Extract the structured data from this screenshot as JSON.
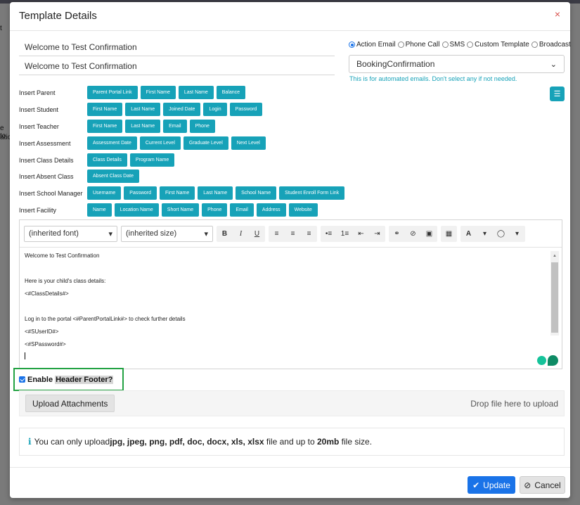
{
  "background": {
    "left_fragments": [
      "t",
      "e to",
      "ation"
    ]
  },
  "modal": {
    "title": "Template Details",
    "close_icon": "×",
    "subject1": "Welcome to Test Confirmation",
    "subject2": "Welcome to Test Confirmation",
    "radio_options": [
      {
        "label": "Action Email",
        "checked": true
      },
      {
        "label": "Phone Call",
        "checked": false
      },
      {
        "label": "SMS",
        "checked": false
      },
      {
        "label": "Custom Template",
        "checked": false
      },
      {
        "label": "Broadcast",
        "checked": false
      }
    ],
    "template_select": "BookingConfirmation",
    "hint": "This is for automated emails. Don't select any if not needed."
  },
  "inserts": [
    {
      "label": "Insert Parent",
      "tags": [
        "Parent Portal Link",
        "First Name",
        "Last Name",
        "Balance"
      ]
    },
    {
      "label": "Insert Student",
      "tags": [
        "First Name",
        "Last Name",
        "Joined Date",
        "Login",
        "Password"
      ]
    },
    {
      "label": "Insert Teacher",
      "tags": [
        "First Name",
        "Last Name",
        "Email",
        "Phone"
      ]
    },
    {
      "label": "Insert Assessment",
      "tags": [
        "Assessment Date",
        "Current Level",
        "Graduate Level",
        "Next Level"
      ]
    },
    {
      "label": "Insert Class Details",
      "tags": [
        "Class Details",
        "Program Name"
      ]
    },
    {
      "label": "Insert Absent Class",
      "tags": [
        "Absent Class Date"
      ]
    },
    {
      "label": "Insert School Manager",
      "tags": [
        "Username",
        "Password",
        "First Name",
        "Last Name",
        "School Name",
        "Student Enroll Form Link"
      ]
    },
    {
      "label": "Insert Facility",
      "tags": [
        "Name",
        "Location Name",
        "Short Name",
        "Phone",
        "Email",
        "Address",
        "Website"
      ]
    }
  ],
  "editor": {
    "font_select": "(inherited font)",
    "size_select": "(inherited size)",
    "lines": [
      "Welcome to Test Confirmation",
      "",
      "Here is your child's class details:",
      "<#ClassDetails#>",
      "",
      "Log in to the portal <#ParentPortalLink#> to check further details",
      "<#SUserID#>",
      "<#SPassword#>"
    ]
  },
  "enable_header_footer": {
    "checked": true,
    "prefix": "Enable",
    "highlight": "Header Footer?"
  },
  "upload": {
    "button": "Upload Attachments",
    "drop_text": "Drop file here to upload"
  },
  "info": {
    "text1": "You can only upload ",
    "formats": "jpg, jpeg, png, pdf, doc, docx, xls, xlsx",
    "text2": " file and up to ",
    "size": "20mb",
    "text3": " file size."
  },
  "footer": {
    "update": "Update",
    "cancel": "Cancel"
  }
}
